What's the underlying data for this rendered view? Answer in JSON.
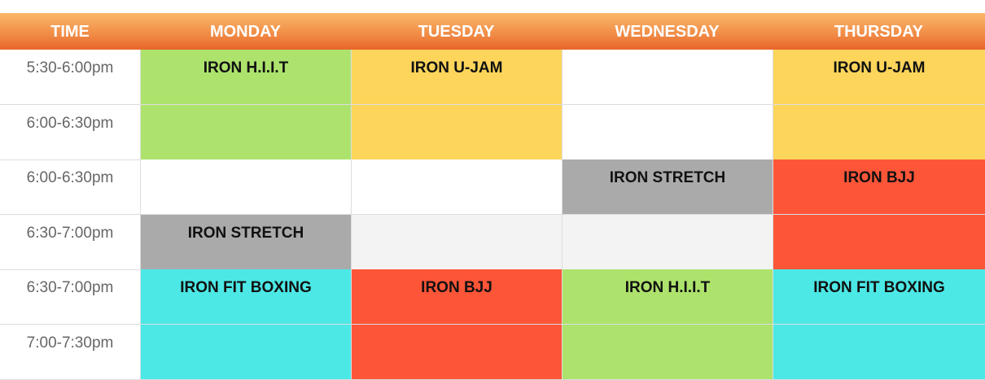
{
  "header": [
    "TIME",
    "MONDAY",
    "TUESDAY",
    "WEDNESDAY",
    "THURSDAY"
  ],
  "colors": {
    "green": "#ade36d",
    "yellow": "#fdd55b",
    "red": "#fd5538",
    "gray": "#aaaaaa",
    "cyan": "#4ce8e6",
    "white": "#ffffff",
    "light": "#f3f3f3"
  },
  "rows": [
    {
      "time": "5:30-6:00pm",
      "cells": [
        {
          "label": "IRON H.I.I.T",
          "color": "green"
        },
        {
          "label": "IRON U-JAM",
          "color": "yellow"
        },
        {
          "label": "",
          "color": "white"
        },
        {
          "label": "IRON U-JAM",
          "color": "yellow"
        }
      ]
    },
    {
      "time": "6:00-6:30pm",
      "cells": [
        {
          "label": "",
          "color": "green"
        },
        {
          "label": "",
          "color": "yellow"
        },
        {
          "label": "",
          "color": "white"
        },
        {
          "label": "",
          "color": "yellow"
        }
      ]
    },
    {
      "time": "6:00-6:30pm",
      "cells": [
        {
          "label": "",
          "color": "white"
        },
        {
          "label": "",
          "color": "white"
        },
        {
          "label": "IRON STRETCH",
          "color": "gray"
        },
        {
          "label": "IRON BJJ",
          "color": "red"
        }
      ]
    },
    {
      "time": "6:30-7:00pm",
      "cells": [
        {
          "label": "IRON STRETCH",
          "color": "gray"
        },
        {
          "label": "",
          "color": "light"
        },
        {
          "label": "",
          "color": "light"
        },
        {
          "label": "",
          "color": "red"
        }
      ]
    },
    {
      "time": "6:30-7:00pm",
      "cells": [
        {
          "label": "IRON FIT BOXING",
          "color": "cyan"
        },
        {
          "label": "IRON BJJ",
          "color": "red"
        },
        {
          "label": "IRON H.I.I.T",
          "color": "green"
        },
        {
          "label": "IRON FIT BOXING",
          "color": "cyan"
        }
      ]
    },
    {
      "time": "7:00-7:30pm",
      "cells": [
        {
          "label": "",
          "color": "cyan"
        },
        {
          "label": "",
          "color": "red"
        },
        {
          "label": "",
          "color": "green"
        },
        {
          "label": "",
          "color": "cyan"
        }
      ]
    }
  ]
}
